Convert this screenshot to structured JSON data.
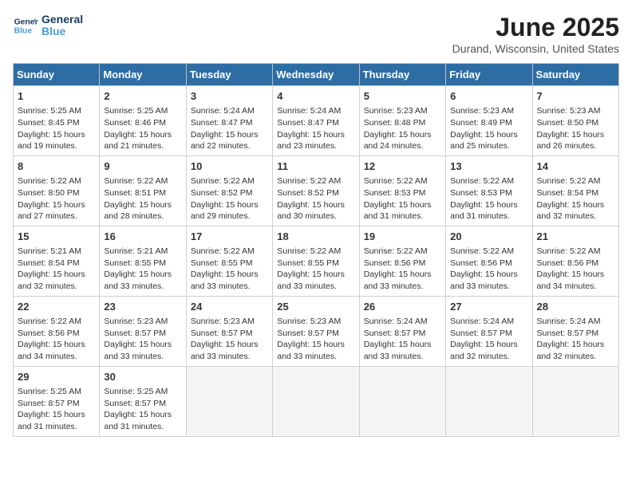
{
  "header": {
    "logo_line1": "General",
    "logo_line2": "Blue",
    "title": "June 2025",
    "subtitle": "Durand, Wisconsin, United States"
  },
  "calendar": {
    "days_of_week": [
      "Sunday",
      "Monday",
      "Tuesday",
      "Wednesday",
      "Thursday",
      "Friday",
      "Saturday"
    ],
    "weeks": [
      [
        {
          "day": "1",
          "info": "Sunrise: 5:25 AM\nSunset: 8:45 PM\nDaylight: 15 hours\nand 19 minutes."
        },
        {
          "day": "2",
          "info": "Sunrise: 5:25 AM\nSunset: 8:46 PM\nDaylight: 15 hours\nand 21 minutes."
        },
        {
          "day": "3",
          "info": "Sunrise: 5:24 AM\nSunset: 8:47 PM\nDaylight: 15 hours\nand 22 minutes."
        },
        {
          "day": "4",
          "info": "Sunrise: 5:24 AM\nSunset: 8:47 PM\nDaylight: 15 hours\nand 23 minutes."
        },
        {
          "day": "5",
          "info": "Sunrise: 5:23 AM\nSunset: 8:48 PM\nDaylight: 15 hours\nand 24 minutes."
        },
        {
          "day": "6",
          "info": "Sunrise: 5:23 AM\nSunset: 8:49 PM\nDaylight: 15 hours\nand 25 minutes."
        },
        {
          "day": "7",
          "info": "Sunrise: 5:23 AM\nSunset: 8:50 PM\nDaylight: 15 hours\nand 26 minutes."
        }
      ],
      [
        {
          "day": "8",
          "info": "Sunrise: 5:22 AM\nSunset: 8:50 PM\nDaylight: 15 hours\nand 27 minutes."
        },
        {
          "day": "9",
          "info": "Sunrise: 5:22 AM\nSunset: 8:51 PM\nDaylight: 15 hours\nand 28 minutes."
        },
        {
          "day": "10",
          "info": "Sunrise: 5:22 AM\nSunset: 8:52 PM\nDaylight: 15 hours\nand 29 minutes."
        },
        {
          "day": "11",
          "info": "Sunrise: 5:22 AM\nSunset: 8:52 PM\nDaylight: 15 hours\nand 30 minutes."
        },
        {
          "day": "12",
          "info": "Sunrise: 5:22 AM\nSunset: 8:53 PM\nDaylight: 15 hours\nand 31 minutes."
        },
        {
          "day": "13",
          "info": "Sunrise: 5:22 AM\nSunset: 8:53 PM\nDaylight: 15 hours\nand 31 minutes."
        },
        {
          "day": "14",
          "info": "Sunrise: 5:22 AM\nSunset: 8:54 PM\nDaylight: 15 hours\nand 32 minutes."
        }
      ],
      [
        {
          "day": "15",
          "info": "Sunrise: 5:21 AM\nSunset: 8:54 PM\nDaylight: 15 hours\nand 32 minutes."
        },
        {
          "day": "16",
          "info": "Sunrise: 5:21 AM\nSunset: 8:55 PM\nDaylight: 15 hours\nand 33 minutes."
        },
        {
          "day": "17",
          "info": "Sunrise: 5:22 AM\nSunset: 8:55 PM\nDaylight: 15 hours\nand 33 minutes."
        },
        {
          "day": "18",
          "info": "Sunrise: 5:22 AM\nSunset: 8:55 PM\nDaylight: 15 hours\nand 33 minutes."
        },
        {
          "day": "19",
          "info": "Sunrise: 5:22 AM\nSunset: 8:56 PM\nDaylight: 15 hours\nand 33 minutes."
        },
        {
          "day": "20",
          "info": "Sunrise: 5:22 AM\nSunset: 8:56 PM\nDaylight: 15 hours\nand 33 minutes."
        },
        {
          "day": "21",
          "info": "Sunrise: 5:22 AM\nSunset: 8:56 PM\nDaylight: 15 hours\nand 34 minutes."
        }
      ],
      [
        {
          "day": "22",
          "info": "Sunrise: 5:22 AM\nSunset: 8:56 PM\nDaylight: 15 hours\nand 34 minutes."
        },
        {
          "day": "23",
          "info": "Sunrise: 5:23 AM\nSunset: 8:57 PM\nDaylight: 15 hours\nand 33 minutes."
        },
        {
          "day": "24",
          "info": "Sunrise: 5:23 AM\nSunset: 8:57 PM\nDaylight: 15 hours\nand 33 minutes."
        },
        {
          "day": "25",
          "info": "Sunrise: 5:23 AM\nSunset: 8:57 PM\nDaylight: 15 hours\nand 33 minutes."
        },
        {
          "day": "26",
          "info": "Sunrise: 5:24 AM\nSunset: 8:57 PM\nDaylight: 15 hours\nand 33 minutes."
        },
        {
          "day": "27",
          "info": "Sunrise: 5:24 AM\nSunset: 8:57 PM\nDaylight: 15 hours\nand 32 minutes."
        },
        {
          "day": "28",
          "info": "Sunrise: 5:24 AM\nSunset: 8:57 PM\nDaylight: 15 hours\nand 32 minutes."
        }
      ],
      [
        {
          "day": "29",
          "info": "Sunrise: 5:25 AM\nSunset: 8:57 PM\nDaylight: 15 hours\nand 31 minutes."
        },
        {
          "day": "30",
          "info": "Sunrise: 5:25 AM\nSunset: 8:57 PM\nDaylight: 15 hours\nand 31 minutes."
        },
        {
          "day": "",
          "info": ""
        },
        {
          "day": "",
          "info": ""
        },
        {
          "day": "",
          "info": ""
        },
        {
          "day": "",
          "info": ""
        },
        {
          "day": "",
          "info": ""
        }
      ]
    ]
  }
}
